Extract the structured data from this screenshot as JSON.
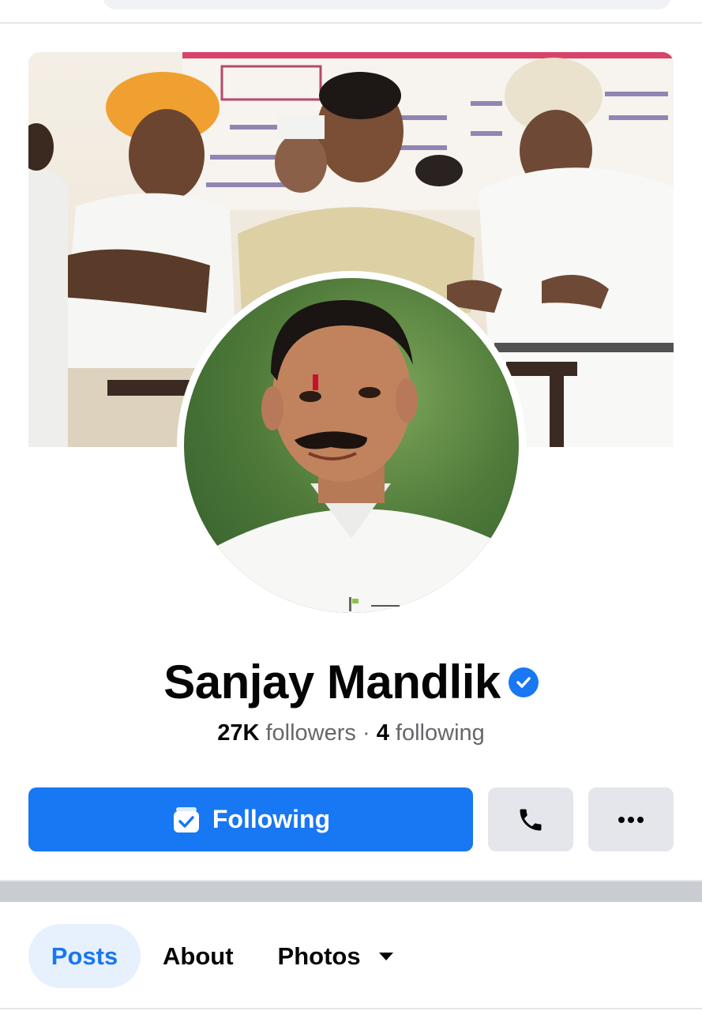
{
  "profile": {
    "name": "Sanjay Mandlik",
    "verified": true,
    "followers_count": "27K",
    "followers_label": "followers",
    "separator": "·",
    "following_count": "4",
    "following_label": "following"
  },
  "actions": {
    "following_label": "Following",
    "following_icon": "following-check-icon",
    "call_icon": "phone-icon",
    "more_icon": "more-dots-icon"
  },
  "tabs": [
    {
      "label": "Posts",
      "active": true
    },
    {
      "label": "About",
      "active": false
    },
    {
      "label": "Photos",
      "active": false,
      "has_dropdown": true
    }
  ],
  "colors": {
    "primary": "#1877f2",
    "button_gray": "#e4e6eb",
    "text": "#050505",
    "secondary_text": "#65676b",
    "active_tab_bg": "#e7f0fd"
  }
}
